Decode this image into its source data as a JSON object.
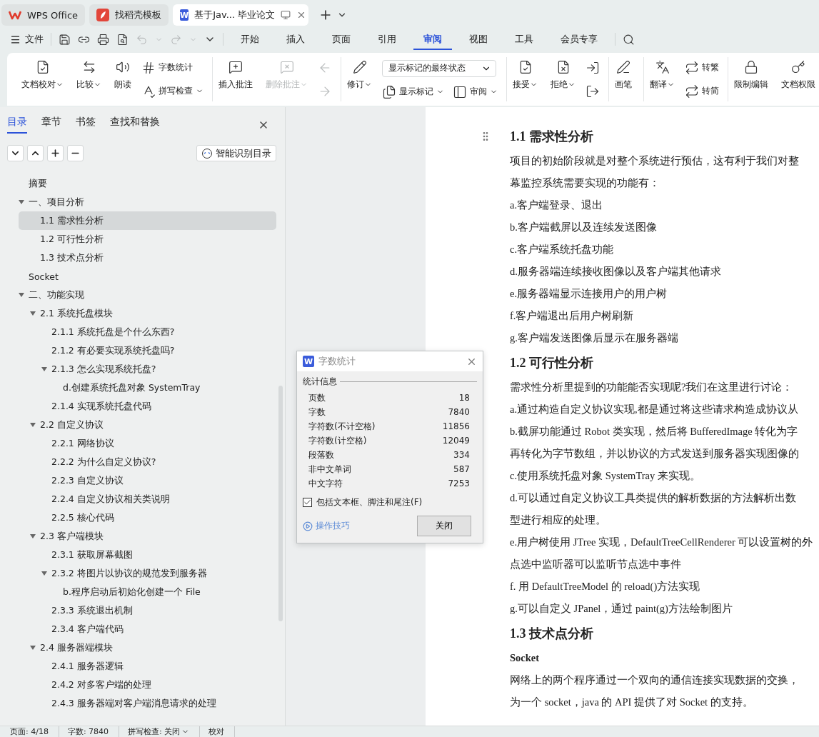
{
  "app_tabs": [
    {
      "kind": "home",
      "label": "WPS Office",
      "selected": false
    },
    {
      "kind": "template",
      "label": "找稻壳模板",
      "selected": false
    },
    {
      "kind": "doc",
      "badge": "W",
      "label": "基于Jav... 毕业论文",
      "selected": true
    }
  ],
  "menu": {
    "file": "文件",
    "tabs": [
      {
        "label": "开始",
        "selected": false
      },
      {
        "label": "插入",
        "selected": false
      },
      {
        "label": "页面",
        "selected": false
      },
      {
        "label": "引用",
        "selected": false
      },
      {
        "label": "审阅",
        "selected": true
      },
      {
        "label": "视图",
        "selected": false
      },
      {
        "label": "工具",
        "selected": false
      },
      {
        "label": "会员专享",
        "selected": false
      }
    ]
  },
  "ribbon": {
    "groups": [
      {
        "items": [
          {
            "kind": "large",
            "label": "文档校对",
            "caret": true,
            "disabled": false
          },
          {
            "kind": "large",
            "label": "比较",
            "caret": true,
            "disabled": false
          },
          {
            "kind": "large",
            "label": "朗读",
            "caret": false,
            "disabled": false
          },
          {
            "kind": "stack",
            "rows": [
              [
                {
                  "kind": "small",
                  "label": "字数统计",
                  "caret": false,
                  "disabled": false
                }
              ],
              [
                {
                  "kind": "small",
                  "label": "拼写检查",
                  "caret": true,
                  "disabled": false
                }
              ]
            ]
          }
        ]
      },
      {
        "items": [
          {
            "kind": "large",
            "label": "插入批注",
            "caret": false,
            "disabled": false
          },
          {
            "kind": "large",
            "label": "删除批注",
            "caret": true,
            "disabled": true
          },
          {
            "kind": "stack",
            "rows": [
              [
                {
                  "kind": "icon",
                  "disabled": true
                }
              ],
              [
                {
                  "kind": "icon",
                  "disabled": true
                }
              ]
            ]
          }
        ]
      },
      {
        "items": [
          {
            "kind": "large",
            "label": "修订",
            "caret": true,
            "disabled": false
          },
          {
            "kind": "stack",
            "rows": [
              [
                {
                  "kind": "select",
                  "value": "显示标记的最终状态"
                }
              ],
              [
                {
                  "kind": "small",
                  "label": "显示标记",
                  "caret": true,
                  "disabled": false
                },
                {
                  "kind": "small",
                  "label": "审阅",
                  "caret": true,
                  "disabled": false
                }
              ]
            ]
          }
        ]
      },
      {
        "items": [
          {
            "kind": "large",
            "label": "接受",
            "caret": true,
            "disabled": false
          },
          {
            "kind": "large",
            "label": "拒绝",
            "caret": true,
            "disabled": false
          },
          {
            "kind": "stack",
            "rows": [
              [
                {
                  "kind": "icon",
                  "disabled": false
                }
              ],
              [
                {
                  "kind": "icon",
                  "disabled": false
                }
              ]
            ]
          }
        ]
      },
      {
        "items": [
          {
            "kind": "large",
            "label": "画笔",
            "caret": false,
            "disabled": false
          }
        ]
      },
      {
        "items": [
          {
            "kind": "large",
            "label": "翻译",
            "caret": true,
            "disabled": false
          },
          {
            "kind": "stack",
            "rows": [
              [
                {
                  "kind": "small",
                  "label": "转繁",
                  "caret": false,
                  "disabled": false
                }
              ],
              [
                {
                  "kind": "small",
                  "label": "转简",
                  "caret": false,
                  "disabled": false
                }
              ]
            ]
          }
        ]
      },
      {
        "items": [
          {
            "kind": "large",
            "label": "限制编辑",
            "caret": false,
            "disabled": false
          },
          {
            "kind": "large",
            "label": "文档权限",
            "caret": false,
            "disabled": false
          }
        ]
      }
    ]
  },
  "sidebar": {
    "tabs": [
      {
        "label": "目录",
        "selected": true
      },
      {
        "label": "章节",
        "selected": false
      },
      {
        "label": "书签",
        "selected": false
      },
      {
        "label": "查找和替换",
        "selected": false
      }
    ],
    "smart_button": "智能识别目录",
    "toc": [
      {
        "label": "摘要",
        "selected": false
      },
      {
        "label": "一、项目分析",
        "selected": false,
        "expanded": true,
        "children": [
          {
            "label": "1.1 需求性分析",
            "selected": true
          },
          {
            "label": "1.2 可行性分析",
            "selected": false
          },
          {
            "label": "1.3 技术点分析",
            "selected": false
          }
        ]
      },
      {
        "label": "Socket",
        "selected": false
      },
      {
        "label": "二、功能实现",
        "selected": false,
        "expanded": true,
        "children": [
          {
            "label": "2.1 系统托盘模块",
            "selected": false,
            "expanded": true,
            "children": [
              {
                "label": "2.1.1 系统托盘是个什么东西?",
                "selected": false
              },
              {
                "label": "2.1.2 有必要实现系统托盘吗?",
                "selected": false
              },
              {
                "label": "2.1.3 怎么实现系统托盘?",
                "selected": false,
                "expanded": true,
                "children": [
                  {
                    "label": "d.创建系统托盘对象 SystemTray",
                    "selected": false
                  }
                ]
              },
              {
                "label": "2.1.4 实现系统托盘代码",
                "selected": false
              }
            ]
          },
          {
            "label": "2.2 自定义协议",
            "selected": false,
            "expanded": true,
            "children": [
              {
                "label": "2.2.1 网络协议",
                "selected": false
              },
              {
                "label": "2.2.2 为什么自定义协议?",
                "selected": false
              },
              {
                "label": "2.2.3 自定义协议",
                "selected": false
              },
              {
                "label": "2.2.4 自定义协议相关类说明",
                "selected": false
              },
              {
                "label": "2.2.5 核心代码",
                "selected": false
              }
            ]
          },
          {
            "label": "2.3 客户端模块",
            "selected": false,
            "expanded": true,
            "children": [
              {
                "label": "2.3.1 获取屏幕截图",
                "selected": false
              },
              {
                "label": "2.3.2 将图片以协议的规范发到服务器",
                "selected": false,
                "expanded": true,
                "children": [
                  {
                    "label": "b.程序启动后初始化创建一个 File",
                    "selected": false
                  }
                ]
              },
              {
                "label": "2.3.3 系统退出机制",
                "selected": false
              },
              {
                "label": "2.3.4 客户端代码",
                "selected": false
              }
            ]
          },
          {
            "label": "2.4 服务器端模块",
            "selected": false,
            "expanded": true,
            "children": [
              {
                "label": "2.4.1 服务器逻辑",
                "selected": false
              },
              {
                "label": "2.4.2 对多客户端的处理",
                "selected": false
              },
              {
                "label": "2.4.3 服务器端对客户端消息请求的处理",
                "selected": false
              }
            ]
          }
        ]
      }
    ]
  },
  "document": {
    "lines": [
      {
        "kind": "heading",
        "text": "1.1 需求性分析",
        "drag_handle": true
      },
      {
        "kind": "text",
        "text": "项目的初始阶段就是对整个系统进行预估，这有利于我们对整"
      },
      {
        "kind": "text",
        "text": "幕监控系统需要实现的功能有："
      },
      {
        "kind": "text",
        "text": "a.客户端登录、退出"
      },
      {
        "kind": "text",
        "text": "b.客户端截屏以及连续发送图像"
      },
      {
        "kind": "text",
        "text": "c.客户端系统托盘功能"
      },
      {
        "kind": "text",
        "text": "d.服务器端连续接收图像以及客户端其他请求"
      },
      {
        "kind": "text",
        "text": "e.服务器端显示连接用户的用户树"
      },
      {
        "kind": "text",
        "text": "f.客户端退出后用户树刷新"
      },
      {
        "kind": "text",
        "text": "g.客户端发送图像后显示在服务器端"
      },
      {
        "kind": "heading",
        "text": "1.2 可行性分析",
        "drag_handle": false
      },
      {
        "kind": "text",
        "text": "需求性分析里提到的功能能否实现呢?我们在这里进行讨论："
      },
      {
        "kind": "text",
        "text": "a.通过构造自定义协议实现,都是通过将这些请求构造成协议从"
      },
      {
        "kind": "text",
        "text": "b.截屏功能通过 Robot 类实现，然后将 BufferedImage 转化为字"
      },
      {
        "kind": "text",
        "text": "再转化为字节数组，并以协议的方式发送到服务器实现图像的"
      },
      {
        "kind": "text",
        "text": "c.使用系统托盘对象 SystemTray 来实现。"
      },
      {
        "kind": "text",
        "text": "d.可以通过自定义协议工具类提供的解析数据的方法解析出数"
      },
      {
        "kind": "text",
        "text": "型进行相应的处理。"
      },
      {
        "kind": "text",
        "text": "e.用户树使用 JTree 实现，DefaultTreeCellRenderer 可以设置树的外"
      },
      {
        "kind": "text",
        "text": "点选中监听器可以监听节点选中事件"
      },
      {
        "kind": "text",
        "text": "f. 用 DefaultTreeModel 的 reload()方法实现"
      },
      {
        "kind": "text",
        "text": "g.可以自定义 JPanel，通过 paint(g)方法绘制图片"
      },
      {
        "kind": "heading",
        "text": "1.3 技术点分析",
        "drag_handle": false
      },
      {
        "kind": "bold",
        "text": "Socket"
      },
      {
        "kind": "text",
        "text": "网络上的两个程序通过一个双向的通信连接实现数据的交换，"
      },
      {
        "kind": "text",
        "text": "为一个 socket，java 的 API 提供了对 Socket 的支持。"
      }
    ]
  },
  "dialog": {
    "badge": "W",
    "title": "字数统计",
    "group": "统计信息",
    "stats": [
      {
        "label": "页数",
        "value": "18"
      },
      {
        "label": "字数",
        "value": "7840"
      },
      {
        "label": "字符数(不计空格)",
        "value": "11856"
      },
      {
        "label": "字符数(计空格)",
        "value": "12049"
      },
      {
        "label": "段落数",
        "value": "334"
      },
      {
        "label": "非中文单词",
        "value": "587"
      },
      {
        "label": "中文字符",
        "value": "7253"
      }
    ],
    "checkbox": {
      "label": "包括文本框、脚注和尾注(F)",
      "checked": true
    },
    "tips_link": "操作技巧",
    "close_button": "关闭"
  },
  "status_bar": [
    {
      "text": "页面: 4/18",
      "caret": false
    },
    {
      "text": "字数: 7840",
      "caret": false
    },
    {
      "text": "拼写检查: 关闭",
      "caret": true
    },
    {
      "text": "校对",
      "caret": false
    }
  ]
}
